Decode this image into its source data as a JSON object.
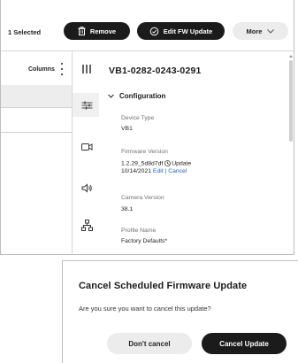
{
  "toolbar": {
    "selected_count": "1 Selected",
    "remove_label": "Remove",
    "edit_fw_label": "Edit FW Update",
    "more_label": "More"
  },
  "table": {
    "columns_label": "Columns"
  },
  "rail_icons": [
    "columns-icon",
    "sliders-icon",
    "camera-icon",
    "audio-icon",
    "network-icon"
  ],
  "details": {
    "device_id": "VB1-0282-0243-0291",
    "section_title": "Configuration",
    "device_type_label": "Device Type",
    "device_type_value": "VB1",
    "firmware_label": "Firmware Version",
    "firmware_value": "1.2.29_5d8d7df",
    "firmware_update_text": "Update",
    "firmware_date": "10/14/2021",
    "edit_link": "Edit",
    "separator": "|",
    "cancel_link": "Cancel",
    "camera_version_label": "Camera Version",
    "camera_version_value": "38.1",
    "profile_label": "Profile Name",
    "profile_value": "Factory Defaults*"
  },
  "dialog": {
    "title": "Cancel Scheduled Firmware Update",
    "message": "Are you sure you want to cancel this update?",
    "dont_cancel_label": "Don't cancel",
    "cancel_update_label": "Cancel Update"
  },
  "colors": {
    "dark_button": "#1b1b1b",
    "light_button": "#ececec",
    "link": "#1f5fd1"
  }
}
